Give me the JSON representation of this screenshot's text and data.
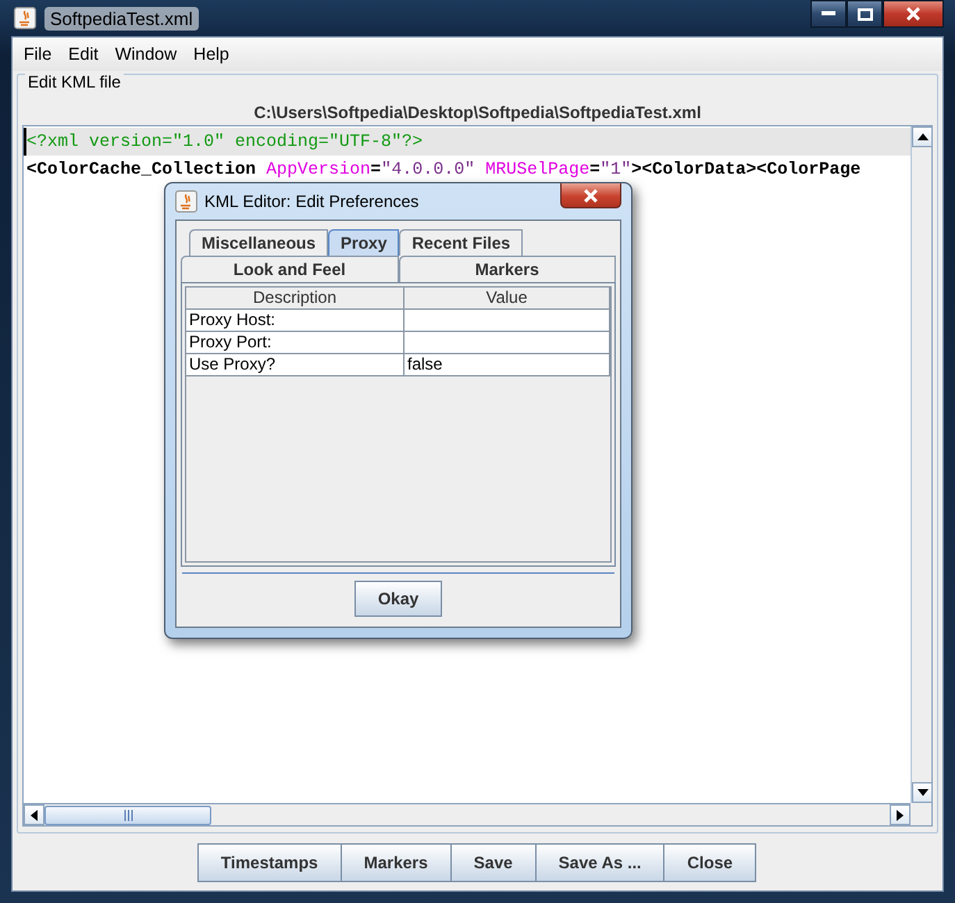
{
  "window": {
    "title": "SoftpediaTest.xml"
  },
  "menu": [
    "File",
    "Edit",
    "Window",
    "Help"
  ],
  "group_title": "Edit KML file",
  "file_path": "C:\\Users\\Softpedia\\Desktop\\Softpedia\\SoftpediaTest.xml",
  "code_lines": [
    {
      "highlighted": true,
      "segments": [
        {
          "kind": "decl",
          "text": "<?xml version=\"1.0\" encoding=\"UTF-8\"?>"
        }
      ]
    },
    {
      "highlighted": false,
      "segments": [
        {
          "kind": "tag",
          "text": "<ColorCache_Collection "
        },
        {
          "kind": "attr",
          "text": "AppVersion"
        },
        {
          "kind": "tag",
          "text": "="
        },
        {
          "kind": "value",
          "text": "\"4.0.0.0\" "
        },
        {
          "kind": "attr",
          "text": "MRUSelPage"
        },
        {
          "kind": "tag",
          "text": "="
        },
        {
          "kind": "value",
          "text": "\"1\""
        },
        {
          "kind": "tag",
          "text": "><ColorData><ColorPage"
        }
      ]
    }
  ],
  "buttons": [
    "Timestamps",
    "Markers",
    "Save",
    "Save As ...",
    "Close"
  ],
  "dialog": {
    "title": "KML Editor: Edit Preferences",
    "tab_rows": [
      [
        {
          "label": "Miscellaneous",
          "selected": false
        },
        {
          "label": "Proxy",
          "selected": true
        },
        {
          "label": "Recent Files",
          "selected": false
        }
      ],
      [
        {
          "label": "Look and Feel",
          "selected": false
        },
        {
          "label": "Markers",
          "selected": false
        }
      ]
    ],
    "columns": [
      "Description",
      "Value"
    ],
    "rows": [
      [
        "Proxy Host:",
        ""
      ],
      [
        "Proxy Port:",
        ""
      ],
      [
        "Use Proxy?",
        "false"
      ]
    ],
    "button": "Okay"
  }
}
